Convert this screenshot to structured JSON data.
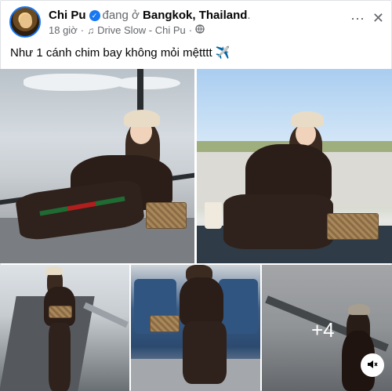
{
  "post": {
    "author": "Chi Pu",
    "status_prefix": "đang ở",
    "location": "Bangkok, Thailand",
    "location_suffix": ".",
    "time": "18 giờ",
    "separator": "·",
    "song": "Drive Slow - Chi Pu",
    "audience_icon": "globe-icon",
    "caption": "Như 1 cánh chim bay không mỏi mệtttt",
    "caption_emoji": "✈️"
  },
  "header_actions": {
    "more_icon": "⋯",
    "close_icon": "✕"
  },
  "photos": {
    "more_count": "+4",
    "mute_icon": "speaker-muted-icon"
  },
  "colors": {
    "accent": "#1877f2",
    "secondary_text": "#65676b",
    "primary_text": "#050505"
  }
}
